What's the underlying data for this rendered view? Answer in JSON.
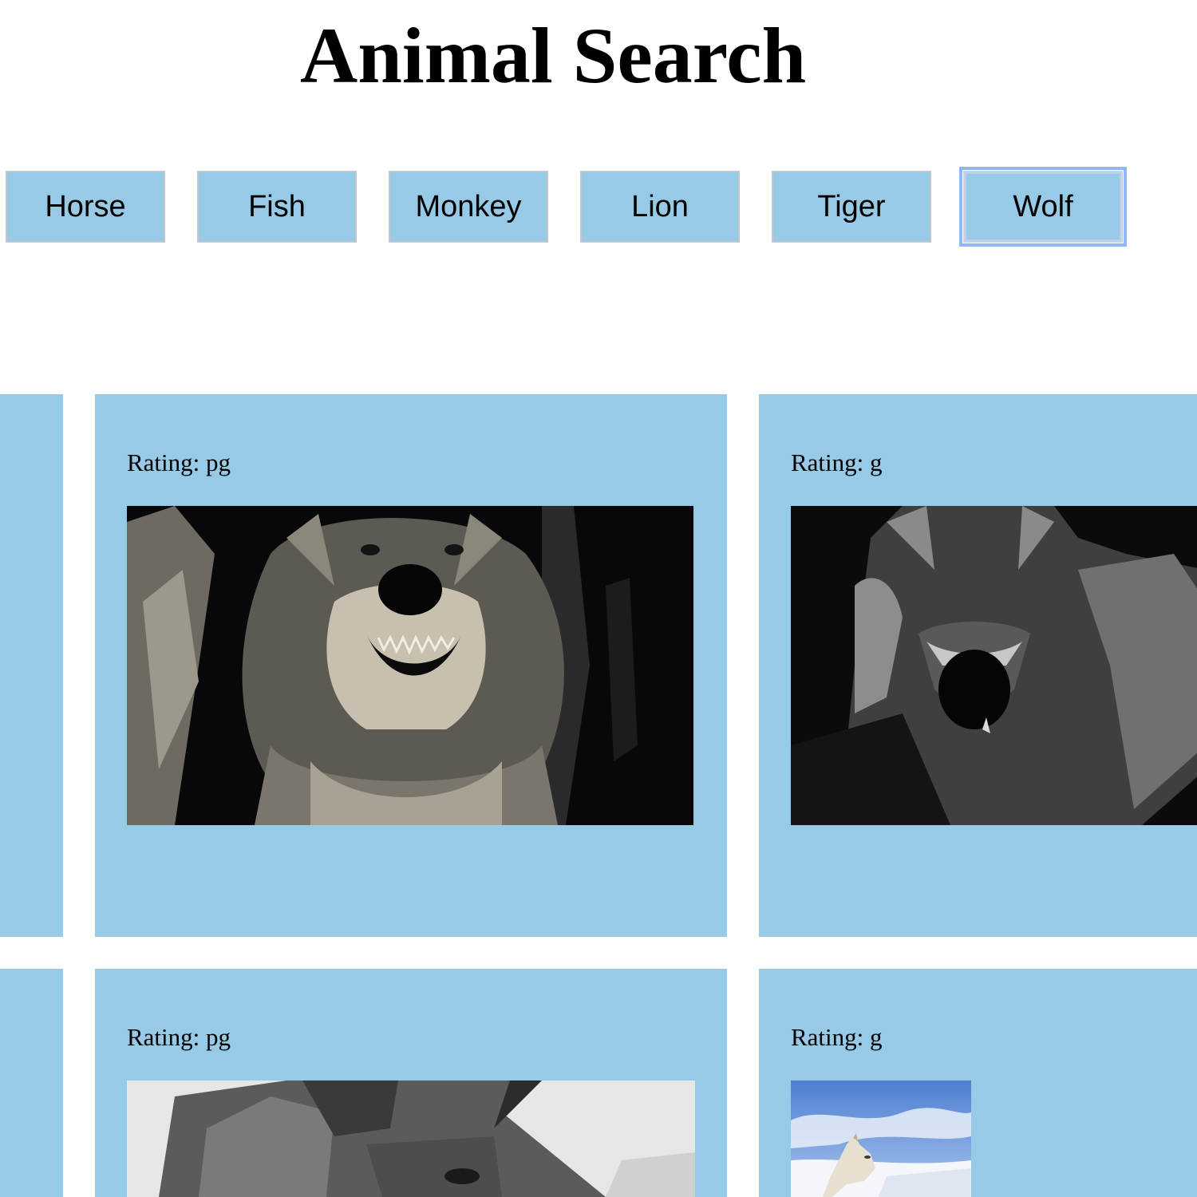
{
  "header": {
    "title": "Animal Search"
  },
  "buttons": [
    {
      "label": "Horse"
    },
    {
      "label": "Fish"
    },
    {
      "label": "Monkey"
    },
    {
      "label": "Lion"
    },
    {
      "label": "Tiger"
    },
    {
      "label": "Wolf",
      "focused": true
    }
  ],
  "results": [
    {
      "rating": "Rating: pg",
      "image": "snarling-wolf-gif"
    },
    {
      "rating": "Rating: g",
      "image": "wolf-face-gif"
    },
    {
      "rating": "Rating: pg",
      "image": "wolf-closeup-gif"
    },
    {
      "rating": "Rating: g",
      "image": "white-wolf-snow-gif"
    }
  ],
  "colors": {
    "button_bg": "#97cae6",
    "card_bg": "#97cae6",
    "focus_ring": "#8fb8f7"
  }
}
